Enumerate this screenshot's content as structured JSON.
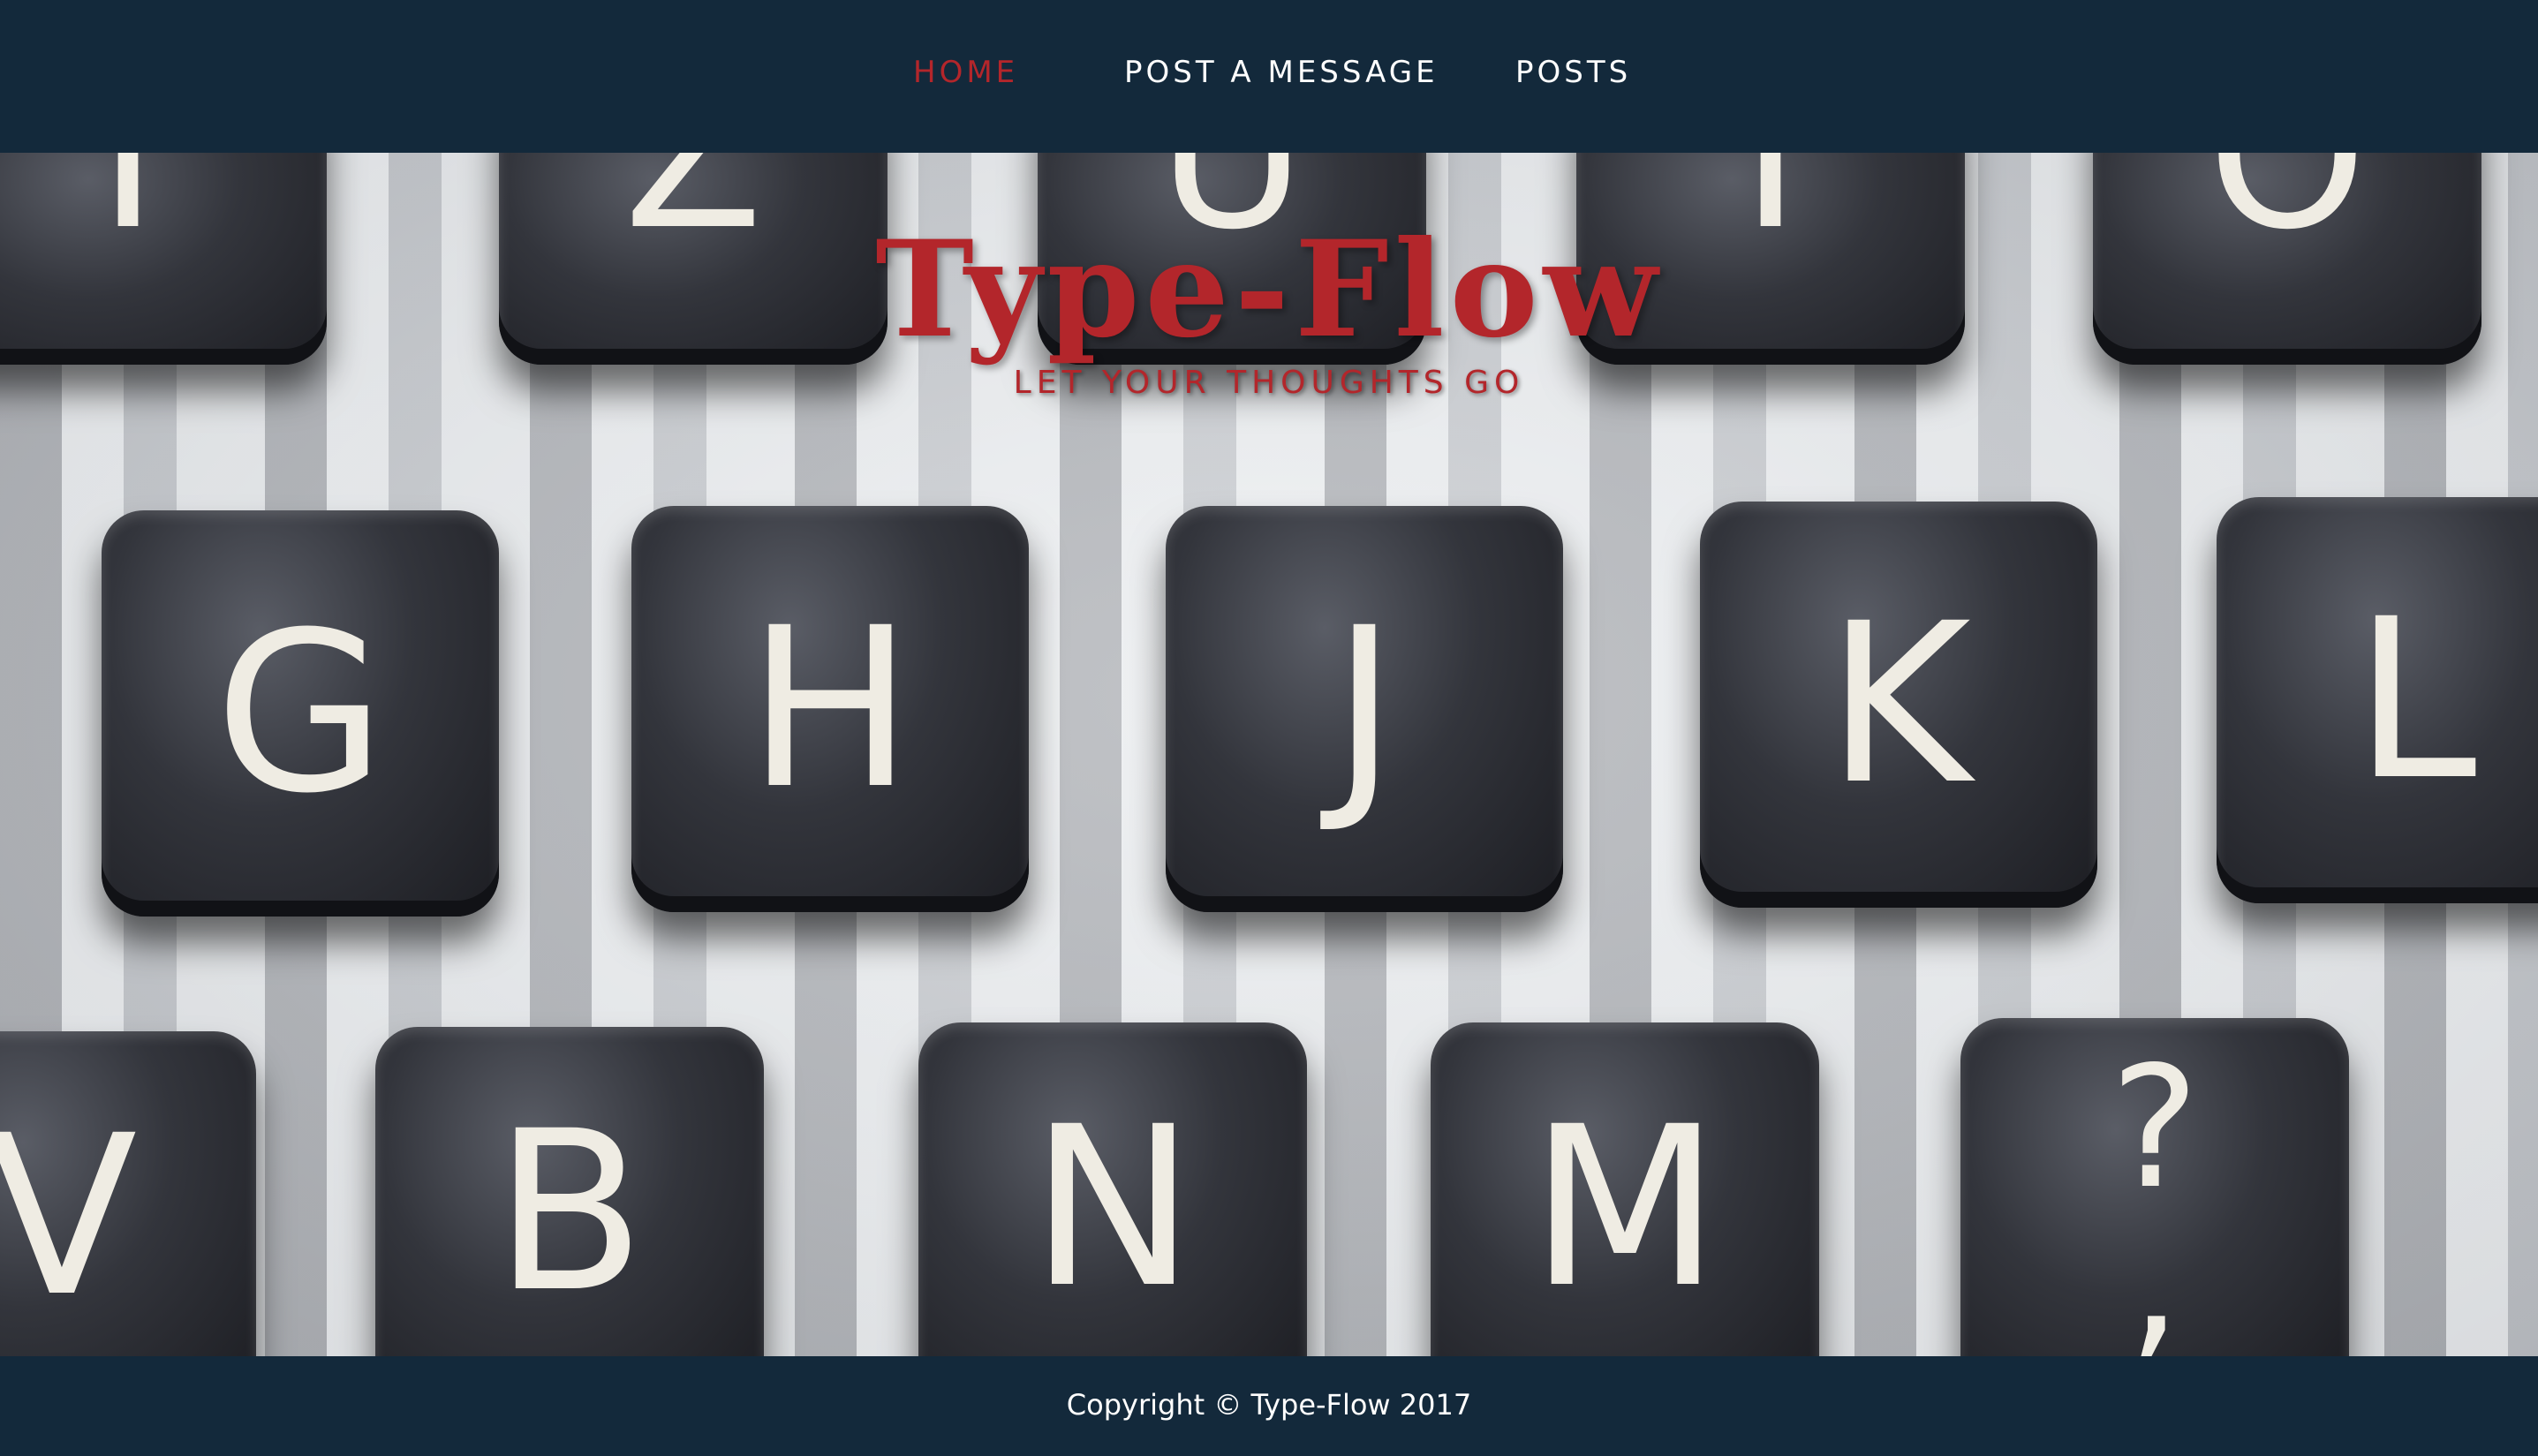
{
  "nav": {
    "items": [
      {
        "label": "HOME",
        "active": true
      },
      {
        "label": "POST A MESSAGE",
        "active": false
      },
      {
        "label": "POSTS",
        "active": false
      }
    ]
  },
  "brand": {
    "title": "Type-Flow",
    "tagline": "LET YOUR THOUGHTS GO"
  },
  "hero": {
    "keys_top": [
      "T",
      "Z",
      "U",
      "I",
      "O"
    ],
    "keys_middle": [
      "G",
      "H",
      "J",
      "K",
      "L"
    ],
    "keys_bottom": [
      "V",
      "B",
      "N",
      "M",
      "?\n,"
    ]
  },
  "footer": {
    "copyright": "Copyright © Type-Flow 2017"
  },
  "colors": {
    "nav_background": "#13293b",
    "accent": "#b3262b",
    "nav_text": "#ffffff"
  }
}
